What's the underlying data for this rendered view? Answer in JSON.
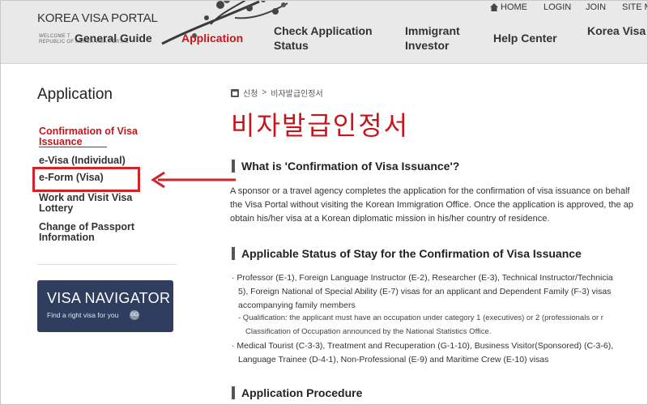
{
  "header": {
    "logo_title": "KOREA VISA PORTAL",
    "logo_sub_line1": "WELCOME T",
    "logo_sub_line2": "REPUBLIC OF KOREA VISA PORTAL",
    "util_links": {
      "home": "HOME",
      "login": "LOGIN",
      "join": "JOIN",
      "sitemap": "SITE M"
    },
    "nav": {
      "general": "General Guide",
      "application": "Application",
      "check_line1": "Check Application",
      "check_line2": "Status",
      "immigrant_line1": "Immigrant",
      "immigrant_line2": "Investor",
      "help": "Help Center",
      "korea": "Korea Visa"
    }
  },
  "sidebar": {
    "title": "Application",
    "items": [
      {
        "label_line1": "Confirmation of Visa",
        "label_line2": "Issuance",
        "active": true
      },
      {
        "label_line1": "e-Visa (Individual)"
      },
      {
        "label_line1": "e-Form (Visa)",
        "highlighted": true
      },
      {
        "label_line1": "Work and Visit Visa",
        "label_line2": "Lottery"
      },
      {
        "label_line1": "Change of Passport",
        "label_line2": "Information"
      }
    ],
    "banner": {
      "title": "VISA NAVIGATOR",
      "subtitle": "Find a right visa for you",
      "go": "GO"
    }
  },
  "main": {
    "breadcrumb": {
      "home_icon": "home-icon",
      "item1": "신청",
      "separator": ">",
      "item2": "비자발급인정서"
    },
    "title": "비자발급인정서",
    "sections": [
      {
        "heading": "What is 'Confirmation of Visa Issuance'?",
        "lines": [
          "A sponsor or a travel agency completes the application for the confirmation of visa issuance on behalf",
          "the Visa Portal without visiting the Korean Immigration Office. Once the application is approved, the ap",
          "obtain his/her visa at a Korean diplomatic mission in his/her country of residence."
        ]
      },
      {
        "heading": "Applicable Status of Stay for the Confirmation of Visa Issuance",
        "bullet1": [
          "· Professor (E-1), Foreign Language Instructor (E-2), Researcher (E-3), Technical Instructor/Technicia",
          "5), Foreign National of Special Ability (E-7) visas for an applicant and Dependent Family (F-3) visas",
          "accompanying family members"
        ],
        "sub1": [
          "- Qualification: the applicant must have an occupation under category 1 (executives) or 2 (professionals or r",
          "Classification of Occupation announced by the National Statistics Office."
        ],
        "bullet2": [
          "· Medical Tourist (C-3-3), Treatment and Recuperation (G-1-10), Business Visitor(Sponsored) (C-3-6),",
          "Language Trainee (D-4-1), Non-Professional (E-9) and Maritime Crew (E-10) visas"
        ]
      },
      {
        "heading": "Application Procedure"
      }
    ]
  },
  "colors": {
    "accent": "#c8151b",
    "highlight_box": "#d0232a",
    "banner_bg": "#2f3d5e",
    "header_bg": "#e9e9e9"
  }
}
